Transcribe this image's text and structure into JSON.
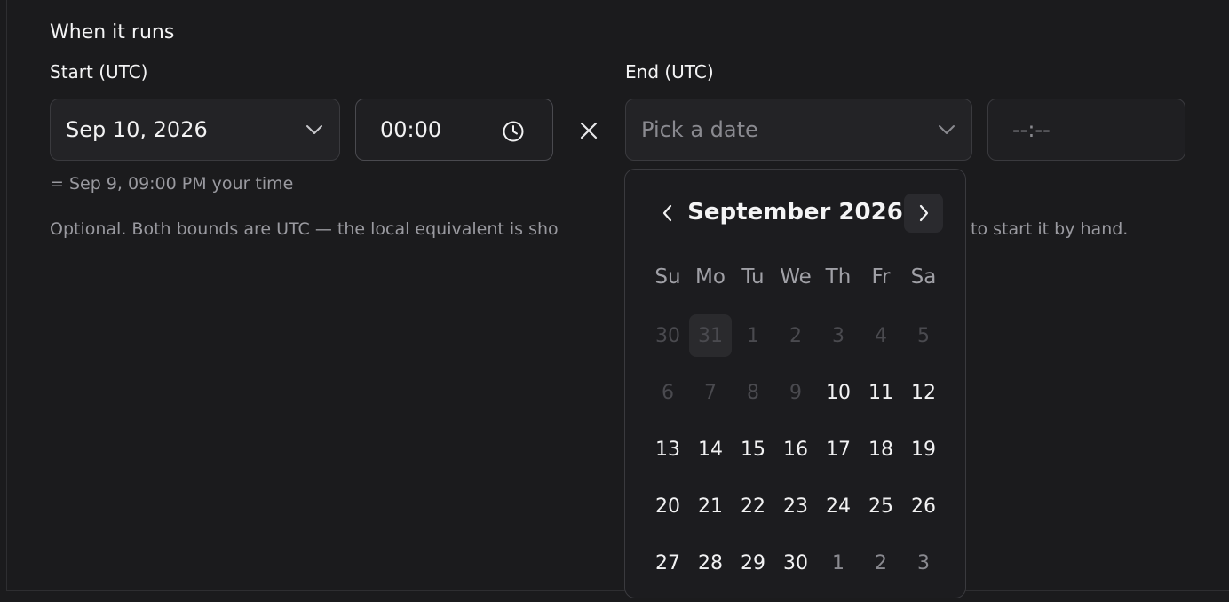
{
  "section_title": "When it runs",
  "start": {
    "label": "Start (UTC)",
    "date_value": "Sep 10, 2026",
    "time_value": "00:00",
    "local_equivalent": "= Sep 9, 09:00 PM your time"
  },
  "end": {
    "label": "End (UTC)",
    "date_placeholder": "Pick a date",
    "time_placeholder": "--:--"
  },
  "note_left": "Optional. Both bounds are UTC — the local equivalent is sho",
  "note_right": "to start it by hand.",
  "icons": {
    "date_dropdown": "chevron-down-icon",
    "time": "clock-icon",
    "clear": "close-icon",
    "prev_month": "chevron-left-icon",
    "next_month": "chevron-right-icon"
  },
  "calendar": {
    "month_label": "September 2026",
    "weekdays": [
      "Su",
      "Mo",
      "Tu",
      "We",
      "Th",
      "Fr",
      "Sa"
    ],
    "weeks": [
      [
        {
          "d": "30",
          "s": "disabled"
        },
        {
          "d": "31",
          "s": "disabled today"
        },
        {
          "d": "1",
          "s": "disabled"
        },
        {
          "d": "2",
          "s": "disabled"
        },
        {
          "d": "3",
          "s": "disabled"
        },
        {
          "d": "4",
          "s": "disabled"
        },
        {
          "d": "5",
          "s": "disabled"
        }
      ],
      [
        {
          "d": "6",
          "s": "disabled"
        },
        {
          "d": "7",
          "s": "disabled"
        },
        {
          "d": "8",
          "s": "disabled"
        },
        {
          "d": "9",
          "s": "disabled"
        },
        {
          "d": "10",
          "s": "enabled"
        },
        {
          "d": "11",
          "s": "enabled"
        },
        {
          "d": "12",
          "s": "enabled"
        }
      ],
      [
        {
          "d": "13",
          "s": "enabled"
        },
        {
          "d": "14",
          "s": "enabled"
        },
        {
          "d": "15",
          "s": "enabled"
        },
        {
          "d": "16",
          "s": "enabled"
        },
        {
          "d": "17",
          "s": "enabled"
        },
        {
          "d": "18",
          "s": "enabled"
        },
        {
          "d": "19",
          "s": "enabled"
        }
      ],
      [
        {
          "d": "20",
          "s": "enabled"
        },
        {
          "d": "21",
          "s": "enabled"
        },
        {
          "d": "22",
          "s": "enabled"
        },
        {
          "d": "23",
          "s": "enabled"
        },
        {
          "d": "24",
          "s": "enabled"
        },
        {
          "d": "25",
          "s": "enabled"
        },
        {
          "d": "26",
          "s": "enabled"
        }
      ],
      [
        {
          "d": "27",
          "s": "enabled"
        },
        {
          "d": "28",
          "s": "enabled"
        },
        {
          "d": "29",
          "s": "enabled"
        },
        {
          "d": "30",
          "s": "enabled"
        },
        {
          "d": "1",
          "s": "outside"
        },
        {
          "d": "2",
          "s": "outside"
        },
        {
          "d": "3",
          "s": "outside"
        }
      ]
    ]
  },
  "colors": {
    "background": "#1b1b1d",
    "text": "#f2f2f3",
    "muted_text": "#9a9aa0",
    "disabled_day": "#4a4a4f",
    "border": "#3a3a3e"
  }
}
